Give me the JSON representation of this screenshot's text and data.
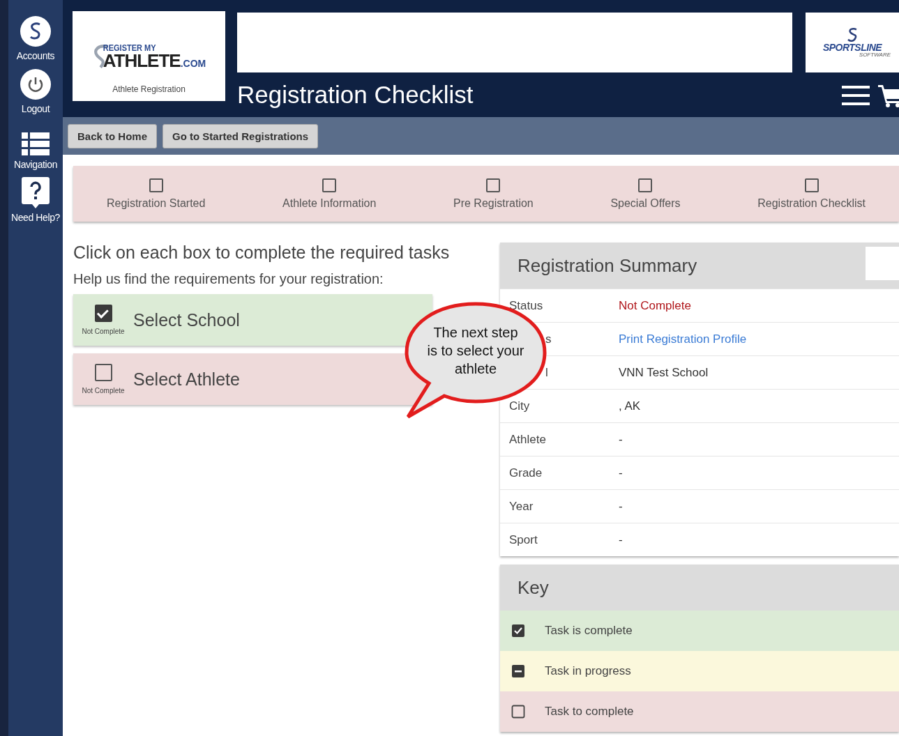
{
  "sidebar": {
    "items": [
      {
        "label": "Accounts",
        "kind": "logo"
      },
      {
        "label": "Logout",
        "kind": "power"
      },
      {
        "label": "Navigation",
        "kind": "list"
      },
      {
        "label": "Need Help?",
        "kind": "help"
      }
    ]
  },
  "header": {
    "logo": {
      "line1": "REGISTER MY",
      "line2": "ATHLETE",
      "suffix": ".COM",
      "caption": "Athlete Registration"
    },
    "title": "Registration Checklist",
    "partner": {
      "name": "SPORTSLINE",
      "sub": "SOFTWARE"
    }
  },
  "toolbar": {
    "buttons": [
      "Back to Home",
      "Go to Started Registrations"
    ]
  },
  "steps": [
    {
      "label": "Registration Started",
      "checked": false
    },
    {
      "label": "Athlete Information",
      "checked": false
    },
    {
      "label": "Pre Registration",
      "checked": false
    },
    {
      "label": "Special Offers",
      "checked": false
    },
    {
      "label": "Registration Checklist",
      "checked": false
    }
  ],
  "intro": {
    "heading": "Click on each box to complete the required tasks",
    "subheading": "Help us find the requirements for your registration:"
  },
  "tasks": [
    {
      "title": "Select School",
      "status": "Not Complete",
      "checked": true
    },
    {
      "title": "Select Athlete",
      "status": "Not Complete",
      "checked": false
    }
  ],
  "callout": {
    "text": "The next step is to select your athlete"
  },
  "summary": {
    "title": "Registration Summary",
    "rows": [
      {
        "label": "Status",
        "value": "Not Complete",
        "kind": "status"
      },
      {
        "label": "s",
        "value": "Print Registration Profile",
        "kind": "link"
      },
      {
        "label": "l",
        "value": "VNN Test School",
        "kind": "text"
      },
      {
        "label": "City",
        "value": ", AK",
        "kind": "text"
      },
      {
        "label": "Athlete",
        "value": "-",
        "kind": "text"
      },
      {
        "label": "Grade",
        "value": "-",
        "kind": "text"
      },
      {
        "label": "Year",
        "value": "-",
        "kind": "text"
      },
      {
        "label": "Sport",
        "value": "-",
        "kind": "text"
      }
    ]
  },
  "key": {
    "title": "Key",
    "items": [
      {
        "label": "Task is complete",
        "kind": "complete"
      },
      {
        "label": "Task in progress",
        "kind": "progress"
      },
      {
        "label": "Task to complete",
        "kind": "todo"
      }
    ]
  }
}
